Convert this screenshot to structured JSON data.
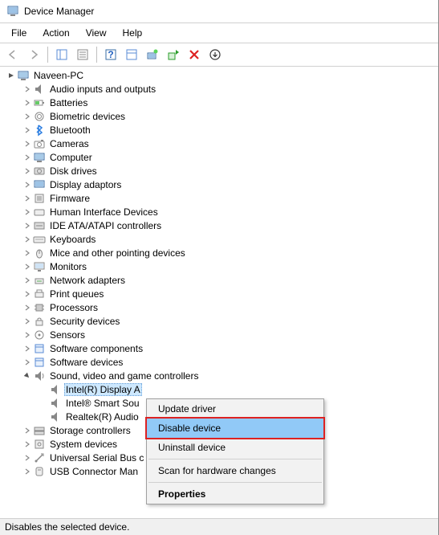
{
  "titlebar": {
    "title": "Device Manager"
  },
  "menubar": {
    "file": "File",
    "action": "Action",
    "view": "View",
    "help": "Help"
  },
  "tree": {
    "root": "Naveen-PC",
    "categories": [
      {
        "icon": "audio",
        "label": "Audio inputs and outputs"
      },
      {
        "icon": "battery",
        "label": "Batteries"
      },
      {
        "icon": "biometric",
        "label": "Biometric devices"
      },
      {
        "icon": "bluetooth",
        "label": "Bluetooth"
      },
      {
        "icon": "camera",
        "label": "Cameras"
      },
      {
        "icon": "computer",
        "label": "Computer"
      },
      {
        "icon": "disk",
        "label": "Disk drives"
      },
      {
        "icon": "display",
        "label": "Display adaptors"
      },
      {
        "icon": "firmware",
        "label": "Firmware"
      },
      {
        "icon": "hid",
        "label": "Human Interface Devices"
      },
      {
        "icon": "ide",
        "label": "IDE ATA/ATAPI controllers"
      },
      {
        "icon": "keyboard",
        "label": "Keyboards"
      },
      {
        "icon": "mouse",
        "label": "Mice and other pointing devices"
      },
      {
        "icon": "monitor",
        "label": "Monitors"
      },
      {
        "icon": "network",
        "label": "Network adapters"
      },
      {
        "icon": "printqueue",
        "label": "Print queues"
      },
      {
        "icon": "processor",
        "label": "Processors"
      },
      {
        "icon": "security",
        "label": "Security devices"
      },
      {
        "icon": "sensor",
        "label": "Sensors"
      },
      {
        "icon": "software",
        "label": "Software components"
      },
      {
        "icon": "software",
        "label": "Software devices"
      }
    ],
    "expanded": {
      "label": "Sound, video and game controllers",
      "children": [
        "Intel(R) Display A",
        "Intel® Smart Sou",
        "Realtek(R) Audio"
      ]
    },
    "after": [
      {
        "icon": "storage",
        "label": "Storage controllers"
      },
      {
        "icon": "system",
        "label": "System devices"
      },
      {
        "icon": "usb",
        "label": "Universal Serial Bus c"
      },
      {
        "icon": "usbconn",
        "label": "USB Connector Man"
      }
    ]
  },
  "context_menu": {
    "update": "Update driver",
    "disable": "Disable device",
    "uninstall": "Uninstall device",
    "scan": "Scan for hardware changes",
    "properties": "Properties"
  },
  "statusbar": {
    "text": "Disables the selected device."
  }
}
